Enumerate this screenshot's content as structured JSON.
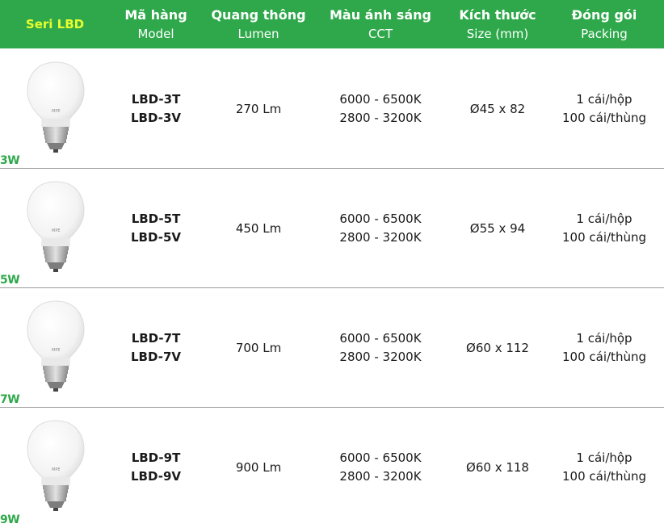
{
  "colors": {
    "header_bg": "#2ea84a",
    "series_text": "#e8ff2e",
    "watt_text": "#2ea84a",
    "row_divider": "#9a9a9a"
  },
  "header": {
    "series": "Seri LBD",
    "model": {
      "vi": "Mã hàng",
      "en": "Model"
    },
    "lumen": {
      "vi": "Quang thông",
      "en": "Lumen"
    },
    "cct": {
      "vi": "Màu ánh sáng",
      "en": "CCT"
    },
    "size": {
      "vi": "Kích thước",
      "en": "Size (mm)"
    },
    "packing": {
      "vi": "Đóng gói",
      "en": "Packing"
    }
  },
  "rows": [
    {
      "watt": "3W",
      "bulb_icon": "led-bulb-icon",
      "bulb_brand": "MPE",
      "models": [
        "LBD-3T",
        "LBD-3V"
      ],
      "lumen": "270 Lm",
      "cct": [
        "6000 - 6500K",
        "2800 - 3200K"
      ],
      "size": "Ø45 x 82",
      "packing": [
        "1 cái/hộp",
        "100 cái/thùng"
      ]
    },
    {
      "watt": "5W",
      "bulb_icon": "led-bulb-icon",
      "bulb_brand": "MPE",
      "models": [
        "LBD-5T",
        "LBD-5V"
      ],
      "lumen": "450 Lm",
      "cct": [
        "6000 - 6500K",
        "2800 - 3200K"
      ],
      "size": "Ø55 x 94",
      "packing": [
        "1 cái/hộp",
        "100 cái/thùng"
      ]
    },
    {
      "watt": "7W",
      "bulb_icon": "led-bulb-icon",
      "bulb_brand": "MPE",
      "models": [
        "LBD-7T",
        "LBD-7V"
      ],
      "lumen": "700 Lm",
      "cct": [
        "6000 - 6500K",
        "2800 - 3200K"
      ],
      "size": "Ø60 x 112",
      "packing": [
        "1 cái/hộp",
        "100 cái/thùng"
      ]
    },
    {
      "watt": "9W",
      "bulb_icon": "led-bulb-icon",
      "bulb_brand": "MPE",
      "models": [
        "LBD-9T",
        "LBD-9V"
      ],
      "lumen": "900 Lm",
      "cct": [
        "6000 - 6500K",
        "2800 - 3200K"
      ],
      "size": "Ø60 x 118",
      "packing": [
        "1 cái/hộp",
        "100 cái/thùng"
      ]
    }
  ]
}
